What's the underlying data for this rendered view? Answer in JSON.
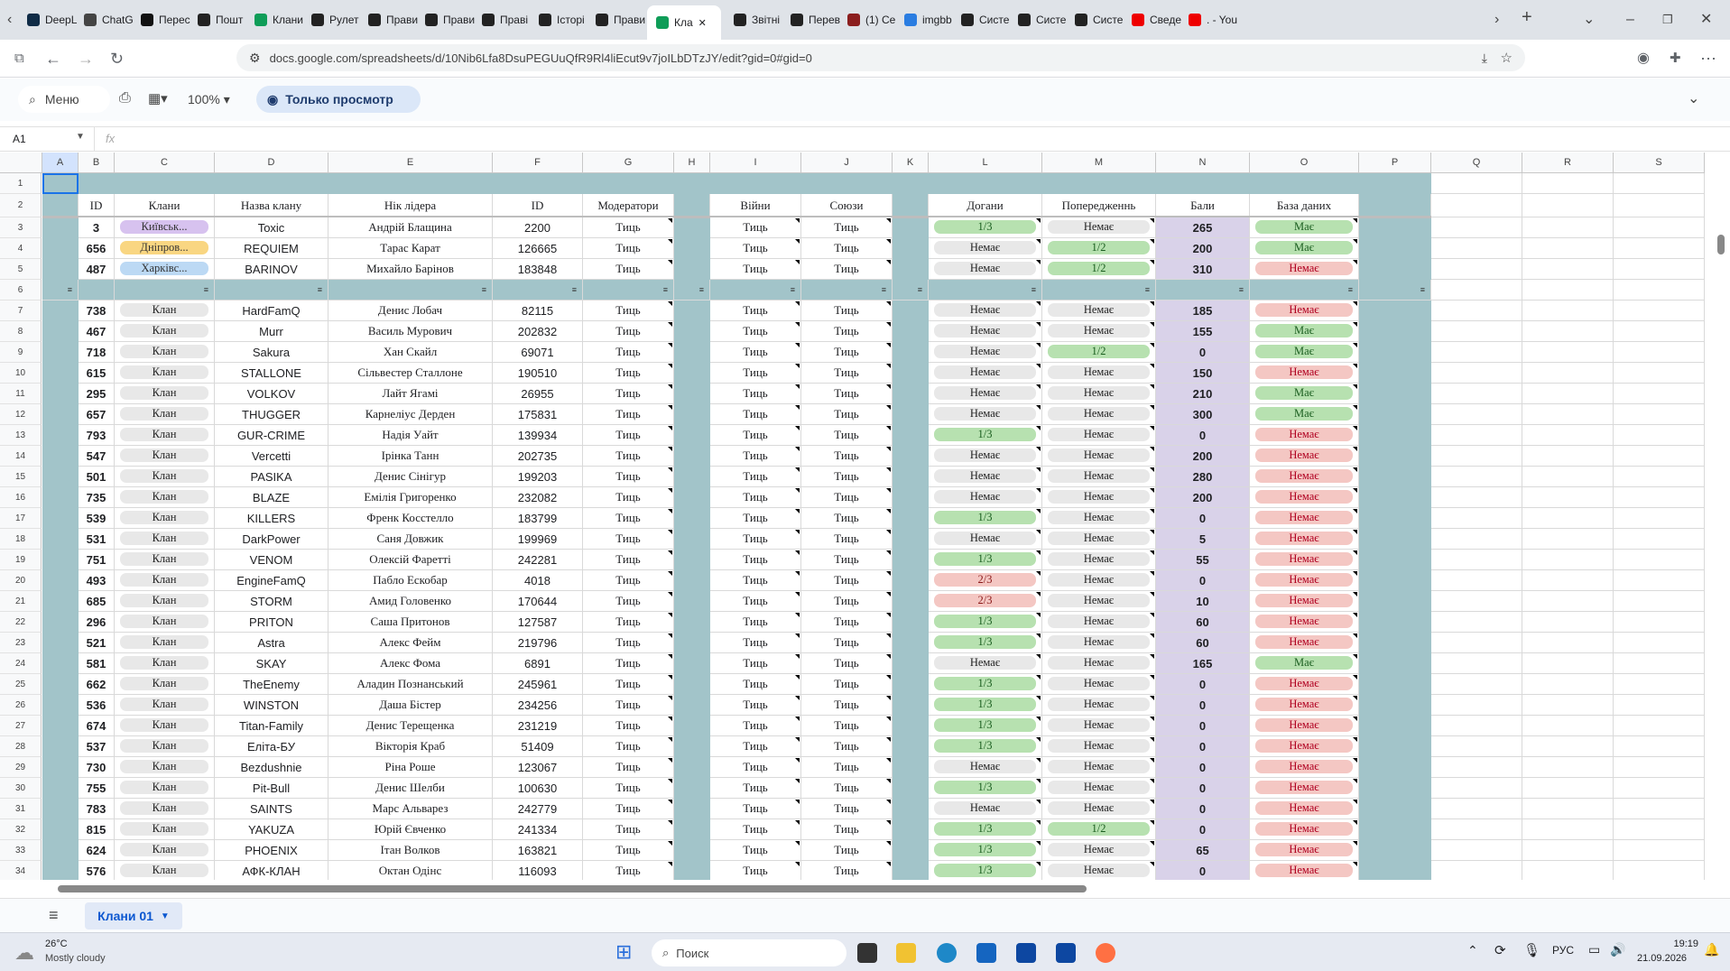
{
  "browser": {
    "tabs": [
      {
        "label": "DeepL",
        "color": "#0f2b46"
      },
      {
        "label": "ChatG",
        "color": "#444"
      },
      {
        "label": "Перес",
        "color": "#111"
      },
      {
        "label": "Пошт",
        "color": "#222"
      },
      {
        "label": "Клани",
        "color": "#0f9d58"
      },
      {
        "label": "Рулет",
        "color": "#222"
      },
      {
        "label": "Прави",
        "color": "#222"
      },
      {
        "label": "Прави",
        "color": "#222"
      },
      {
        "label": "Праві",
        "color": "#222"
      },
      {
        "label": "Історі",
        "color": "#222"
      },
      {
        "label": "Прави",
        "color": "#222"
      },
      {
        "label": "Кла",
        "color": "#0f9d58",
        "active": true
      },
      {
        "label": "Звітні",
        "color": "#222"
      },
      {
        "label": "Перев",
        "color": "#222"
      },
      {
        "label": "(1) Се",
        "color": "#8b1e1e"
      },
      {
        "label": "imgbb",
        "color": "#2a7de1"
      },
      {
        "label": "Систе",
        "color": "#222"
      },
      {
        "label": "Систе",
        "color": "#222"
      },
      {
        "label": "Систе",
        "color": "#222"
      },
      {
        "label": "Сведе",
        "color": "#e00"
      },
      {
        "label": ". - You",
        "color": "#e00"
      }
    ],
    "url": "docs.google.com/spreadsheets/d/10Nib6Lfa8DsuPEGUuQfR9Rl4liEcut9v7joILbDTzJY/edit?gid=0#gid=0"
  },
  "toolbar": {
    "menu_label": "Меню",
    "zoom": "100%",
    "view_only_label": "Только просмотр",
    "name_box": "A1",
    "fx": "fx"
  },
  "columns": [
    "A",
    "B",
    "C",
    "D",
    "E",
    "F",
    "G",
    "H",
    "I",
    "J",
    "K",
    "L",
    "M",
    "N",
    "O",
    "P",
    "Q",
    "R",
    "S"
  ],
  "header": {
    "row_num": "2",
    "B": "ID",
    "C": "Клани",
    "D": "Назва клану",
    "E": "Нік лідера",
    "F": "ID",
    "G": "Модератори",
    "I": "Війни",
    "J": "Союзи",
    "L": "Догани",
    "M": "Попередженнь",
    "N": "Бали",
    "O": "База даних"
  },
  "rows": [
    {
      "n": "3",
      "id": "3",
      "clan": "Київськ...",
      "cls": "purple",
      "name": "Toxic",
      "leader": "Андрій Блащина",
      "pid": "2200",
      "mod": "Тиць",
      "war": "Тиць",
      "alliance": "Тиць",
      "reprimand": "1/3",
      "warn": "Немає",
      "points": "265",
      "db": "Має"
    },
    {
      "n": "4",
      "id": "656",
      "clan": "Дніпров...",
      "cls": "yellow",
      "name": "REQUIEM",
      "leader": "Тарас Карат",
      "pid": "126665",
      "mod": "Тиць",
      "war": "Тиць",
      "alliance": "Тиць",
      "reprimand": "Немає",
      "warn": "1/2",
      "points": "200",
      "db": "Має"
    },
    {
      "n": "5",
      "id": "487",
      "clan": "Харківс...",
      "cls": "blue",
      "name": "BARINOV",
      "leader": "Михайло Барінов",
      "pid": "183848",
      "mod": "Тиць",
      "war": "Тиць",
      "alliance": "Тиць",
      "reprimand": "Немає",
      "warn": "1/2",
      "points": "310",
      "db": "Немає"
    },
    {
      "n": "7",
      "id": "738",
      "clan": "Клан",
      "name": "HardFamQ",
      "leader": "Денис Лобач",
      "pid": "82115",
      "mod": "Тиць",
      "war": "Тиць",
      "alliance": "Тиць",
      "reprimand": "Немає",
      "warn": "Немає",
      "points": "185",
      "db": "Немає"
    },
    {
      "n": "8",
      "id": "467",
      "clan": "Клан",
      "name": "Murr",
      "leader": "Василь Мурович",
      "pid": "202832",
      "mod": "Тиць",
      "war": "Тиць",
      "alliance": "Тиць",
      "reprimand": "Немає",
      "warn": "Немає",
      "points": "155",
      "db": "Має"
    },
    {
      "n": "9",
      "id": "718",
      "clan": "Клан",
      "name": "Sakura",
      "leader": "Хан Скайл",
      "pid": "69071",
      "mod": "Тиць",
      "war": "Тиць",
      "alliance": "Тиць",
      "reprimand": "Немає",
      "warn": "1/2",
      "points": "0",
      "db": "Має"
    },
    {
      "n": "10",
      "id": "615",
      "clan": "Клан",
      "name": "STALLONE",
      "leader": "Сільвестер Сталлоне",
      "pid": "190510",
      "mod": "Тиць",
      "war": "Тиць",
      "alliance": "Тиць",
      "reprimand": "Немає",
      "warn": "Немає",
      "points": "150",
      "db": "Немає"
    },
    {
      "n": "11",
      "id": "295",
      "clan": "Клан",
      "name": "VOLKOV",
      "leader": "Лайт Ягамі",
      "pid": "26955",
      "mod": "Тиць",
      "war": "Тиць",
      "alliance": "Тиць",
      "reprimand": "Немає",
      "warn": "Немає",
      "points": "210",
      "db": "Має"
    },
    {
      "n": "12",
      "id": "657",
      "clan": "Клан",
      "name": "THUGGER",
      "leader": "Карнеліус Дерден",
      "pid": "175831",
      "mod": "Тиць",
      "war": "Тиць",
      "alliance": "Тиць",
      "reprimand": "Немає",
      "warn": "Немає",
      "points": "300",
      "db": "Має"
    },
    {
      "n": "13",
      "id": "793",
      "clan": "Клан",
      "name": "GUR-CRIME",
      "leader": "Надія Уайт",
      "pid": "139934",
      "mod": "Тиць",
      "war": "Тиць",
      "alliance": "Тиць",
      "reprimand": "1/3",
      "warn": "Немає",
      "points": "0",
      "db": "Немає"
    },
    {
      "n": "14",
      "id": "547",
      "clan": "Клан",
      "name": "Vercetti",
      "leader": "Ірінка Танн",
      "pid": "202735",
      "mod": "Тиць",
      "war": "Тиць",
      "alliance": "Тиць",
      "reprimand": "Немає",
      "warn": "Немає",
      "points": "200",
      "db": "Немає"
    },
    {
      "n": "15",
      "id": "501",
      "clan": "Клан",
      "name": "PASIKA",
      "leader": "Денис Сінігур",
      "pid": "199203",
      "mod": "Тиць",
      "war": "Тиць",
      "alliance": "Тиць",
      "reprimand": "Немає",
      "warn": "Немає",
      "points": "280",
      "db": "Немає"
    },
    {
      "n": "16",
      "id": "735",
      "clan": "Клан",
      "name": "BLAZE",
      "leader": "Емілія Григоренко",
      "pid": "232082",
      "mod": "Тиць",
      "war": "Тиць",
      "alliance": "Тиць",
      "reprimand": "Немає",
      "warn": "Немає",
      "points": "200",
      "db": "Немає"
    },
    {
      "n": "17",
      "id": "539",
      "clan": "Клан",
      "name": "KILLERS",
      "leader": "Френк Косстелло",
      "pid": "183799",
      "mod": "Тиць",
      "war": "Тиць",
      "alliance": "Тиць",
      "reprimand": "1/3",
      "warn": "Немає",
      "points": "0",
      "db": "Немає"
    },
    {
      "n": "18",
      "id": "531",
      "clan": "Клан",
      "name": "DarkPower",
      "leader": "Саня Довжик",
      "pid": "199969",
      "mod": "Тиць",
      "war": "Тиць",
      "alliance": "Тиць",
      "reprimand": "Немає",
      "warn": "Немає",
      "points": "5",
      "db": "Немає"
    },
    {
      "n": "19",
      "id": "751",
      "clan": "Клан",
      "name": "VENOM",
      "leader": "Олексій Фаретті",
      "pid": "242281",
      "mod": "Тиць",
      "war": "Тиць",
      "alliance": "Тиць",
      "reprimand": "1/3",
      "warn": "Немає",
      "points": "55",
      "db": "Немає"
    },
    {
      "n": "20",
      "id": "493",
      "clan": "Клан",
      "name": "EngineFamQ",
      "leader": "Пабло Ескобар",
      "pid": "4018",
      "mod": "Тиць",
      "war": "Тиць",
      "alliance": "Тиць",
      "reprimand": "2/3",
      "warn": "Немає",
      "points": "0",
      "db": "Немає"
    },
    {
      "n": "21",
      "id": "685",
      "clan": "Клан",
      "name": "STORM",
      "leader": "Амид Головенко",
      "pid": "170644",
      "mod": "Тиць",
      "war": "Тиць",
      "alliance": "Тиць",
      "reprimand": "2/3",
      "warn": "Немає",
      "points": "10",
      "db": "Немає"
    },
    {
      "n": "22",
      "id": "296",
      "clan": "Клан",
      "name": "PRITON",
      "leader": "Саша Притонов",
      "pid": "127587",
      "mod": "Тиць",
      "war": "Тиць",
      "alliance": "Тиць",
      "reprimand": "1/3",
      "warn": "Немає",
      "points": "60",
      "db": "Немає"
    },
    {
      "n": "23",
      "id": "521",
      "clan": "Клан",
      "name": "Astra",
      "leader": "Алекс Фейм",
      "pid": "219796",
      "mod": "Тиць",
      "war": "Тиць",
      "alliance": "Тиць",
      "reprimand": "1/3",
      "warn": "Немає",
      "points": "60",
      "db": "Немає"
    },
    {
      "n": "24",
      "id": "581",
      "clan": "Клан",
      "name": "SKAY",
      "leader": "Алекс Фома",
      "pid": "6891",
      "mod": "Тиць",
      "war": "Тиць",
      "alliance": "Тиць",
      "reprimand": "Немає",
      "warn": "Немає",
      "points": "165",
      "db": "Має"
    },
    {
      "n": "25",
      "id": "662",
      "clan": "Клан",
      "name": "TheEnemy",
      "leader": "Аладин Познанський",
      "pid": "245961",
      "mod": "Тиць",
      "war": "Тиць",
      "alliance": "Тиць",
      "reprimand": "1/3",
      "warn": "Немає",
      "points": "0",
      "db": "Немає"
    },
    {
      "n": "26",
      "id": "536",
      "clan": "Клан",
      "name": "WINSTON",
      "leader": "Даша Бістер",
      "pid": "234256",
      "mod": "Тиць",
      "war": "Тиць",
      "alliance": "Тиць",
      "reprimand": "1/3",
      "warn": "Немає",
      "points": "0",
      "db": "Немає"
    },
    {
      "n": "27",
      "id": "674",
      "clan": "Клан",
      "name": "Titan-Family",
      "leader": "Денис Терещенка",
      "pid": "231219",
      "mod": "Тиць",
      "war": "Тиць",
      "alliance": "Тиць",
      "reprimand": "1/3",
      "warn": "Немає",
      "points": "0",
      "db": "Немає"
    },
    {
      "n": "28",
      "id": "537",
      "clan": "Клан",
      "name": "Еліта-БУ",
      "leader": "Вікторія Краб",
      "pid": "51409",
      "mod": "Тиць",
      "war": "Тиць",
      "alliance": "Тиць",
      "reprimand": "1/3",
      "warn": "Немає",
      "points": "0",
      "db": "Немає"
    },
    {
      "n": "29",
      "id": "730",
      "clan": "Клан",
      "name": "Bezdushnie",
      "leader": "Ріна Роше",
      "pid": "123067",
      "mod": "Тиць",
      "war": "Тиць",
      "alliance": "Тиць",
      "reprimand": "Немає",
      "warn": "Немає",
      "points": "0",
      "db": "Немає"
    },
    {
      "n": "30",
      "id": "755",
      "clan": "Клан",
      "name": "Pit-Bull",
      "leader": "Денис Шелби",
      "pid": "100630",
      "mod": "Тиць",
      "war": "Тиць",
      "alliance": "Тиць",
      "reprimand": "1/3",
      "warn": "Немає",
      "points": "0",
      "db": "Немає"
    },
    {
      "n": "31",
      "id": "783",
      "clan": "Клан",
      "name": "SAINTS",
      "leader": "Марс Альварез",
      "pid": "242779",
      "mod": "Тиць",
      "war": "Тиць",
      "alliance": "Тиць",
      "reprimand": "Немає",
      "warn": "Немає",
      "points": "0",
      "db": "Немає"
    },
    {
      "n": "32",
      "id": "815",
      "clan": "Клан",
      "name": "YAKUZA",
      "leader": "Юрій Євченко",
      "pid": "241334",
      "mod": "Тиць",
      "war": "Тиць",
      "alliance": "Тиць",
      "reprimand": "1/3",
      "warn": "1/2",
      "points": "0",
      "db": "Немає"
    },
    {
      "n": "33",
      "id": "624",
      "clan": "Клан",
      "name": "PHOENIX",
      "leader": "Ітан Волков",
      "pid": "163821",
      "mod": "Тиць",
      "war": "Тиць",
      "alliance": "Тиць",
      "reprimand": "1/3",
      "warn": "Немає",
      "points": "65",
      "db": "Немає"
    },
    {
      "n": "34",
      "id": "576",
      "clan": "Клан",
      "name": "АФК-КЛАН",
      "leader": "Октан Одінс",
      "pid": "116093",
      "mod": "Тиць",
      "war": "Тиць",
      "alliance": "Тиць",
      "reprimand": "1/3",
      "warn": "Немає",
      "points": "0",
      "db": "Немає"
    }
  ],
  "sheet_tab": "Клани 01",
  "taskbar": {
    "temp": "26°C",
    "weather": "Mostly cloudy",
    "search_placeholder": "Поиск",
    "lang": "РУС",
    "time": "19:19",
    "date": "21.09.2026"
  },
  "colors": {
    "teal": "#a2c4c9",
    "header_green": "#d9ead3",
    "lavender": "#d9d2e9",
    "chip_green": "#b7e1b0",
    "chip_red": "#f4c7c3",
    "chip_gray": "#e8e8e8"
  }
}
